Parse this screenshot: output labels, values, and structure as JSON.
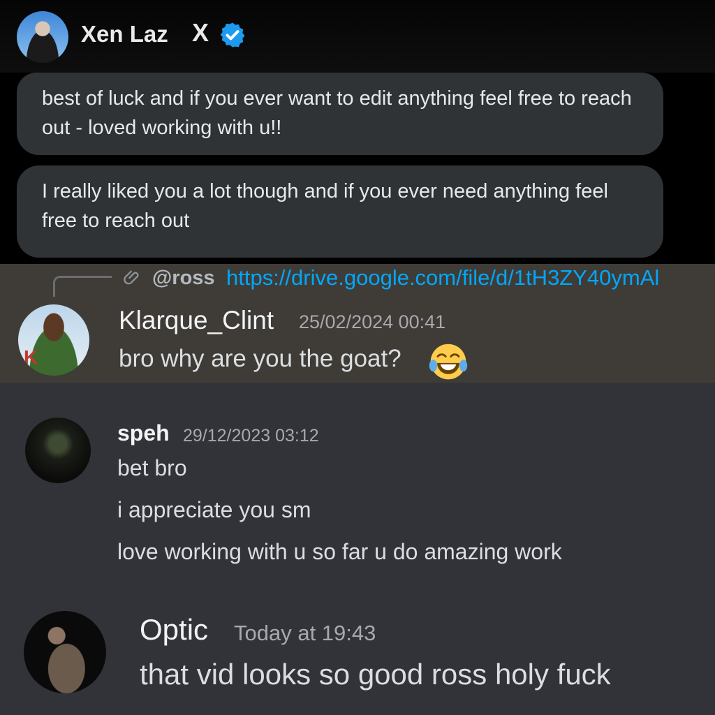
{
  "x_dm": {
    "contact_name": "Xen Laz",
    "badge_glyph": "X",
    "verified_icon": "verified-badge-icon",
    "messages": [
      "best of luck and if you ever want to edit anything feel free to reach out - loved working with u!!",
      "I really liked you a lot though and if you ever need anything feel free to reach out"
    ]
  },
  "discord": {
    "reply_preview": {
      "mention": "@ross",
      "link_text": "https://drive.google.com/file/d/1tH3ZY40ymAl",
      "icon": "attachment-icon"
    },
    "messages": [
      {
        "author": "Klarque_Clint",
        "timestamp": "25/02/2024 00:41",
        "lines": [
          "bro why are you the goat?"
        ],
        "emoji": "joy-emoji-icon",
        "avatar_letter": "K"
      },
      {
        "author": "speh",
        "timestamp": "29/12/2023 03:12",
        "lines": [
          "bet bro",
          "i appreciate you sm",
          "love working with u so far u do amazing work"
        ]
      },
      {
        "author": "Optic",
        "timestamp": "Today at 19:43",
        "lines": [
          "that vid looks so good ross holy fuck"
        ]
      }
    ]
  },
  "colors": {
    "x_background": "#000000",
    "x_bubble": "#2f3336",
    "discord_background": "#313338",
    "reply_highlight": "#3f3c37",
    "link": "#00a8fc",
    "verified": "#1d9bf0"
  }
}
